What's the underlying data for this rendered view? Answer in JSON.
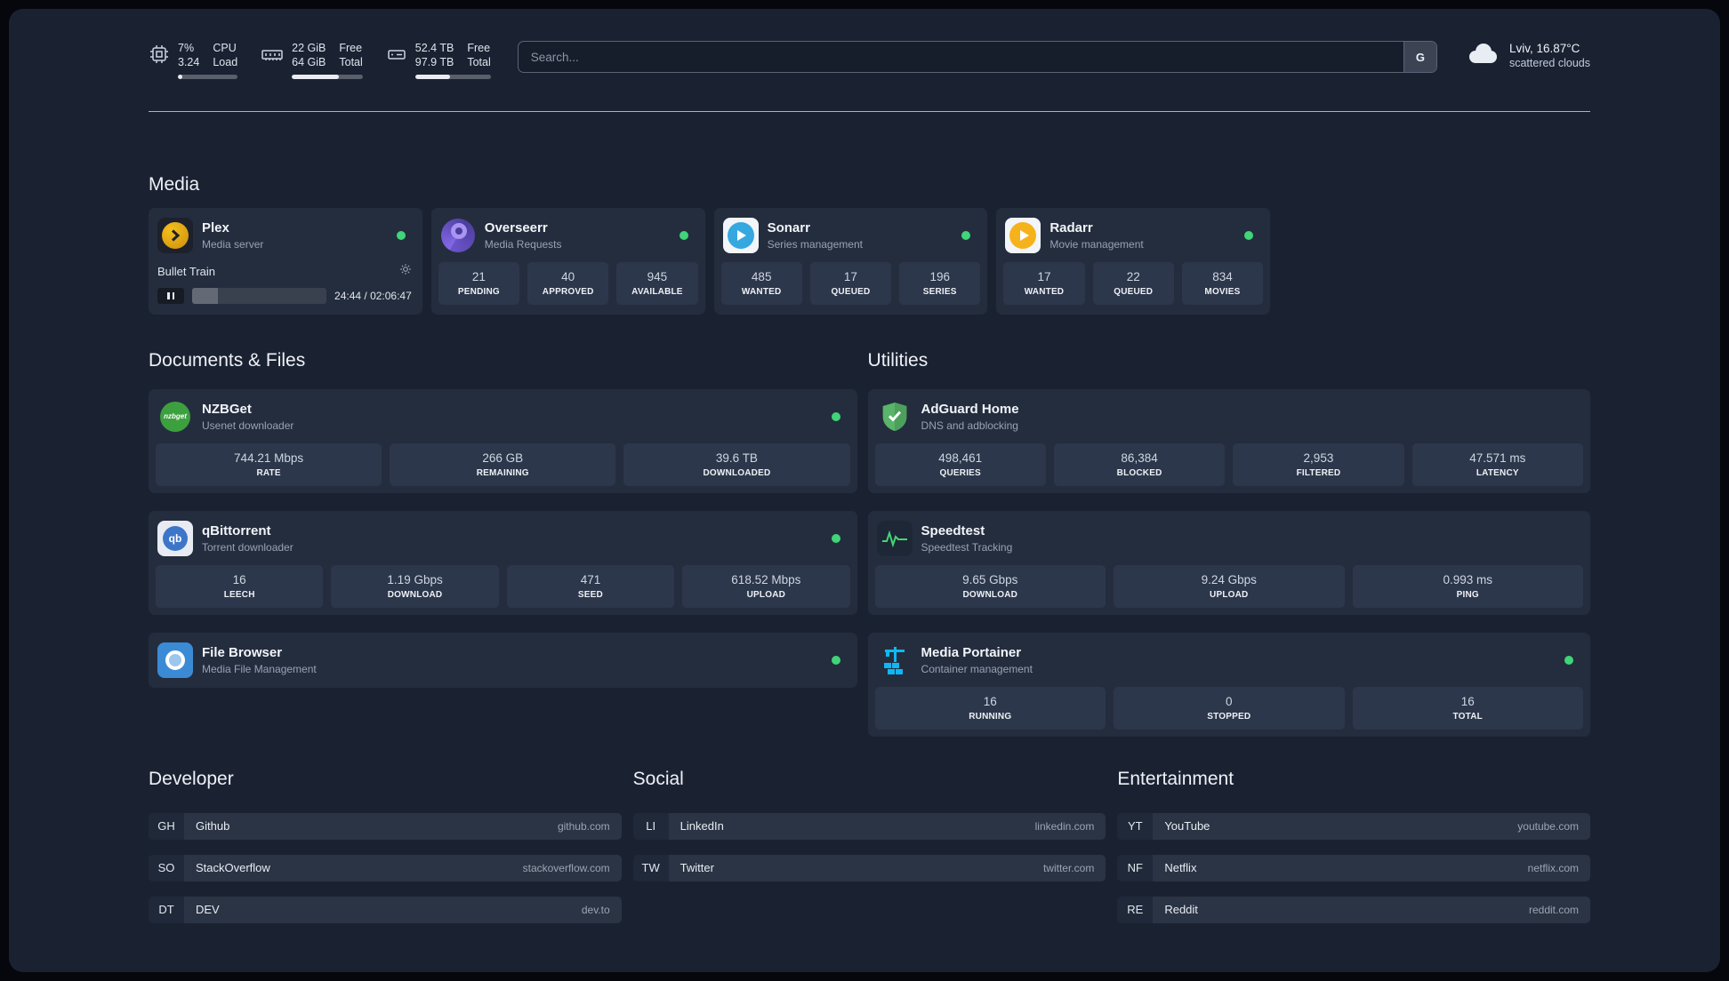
{
  "topbar": {
    "cpu": {
      "percent": "7%",
      "load": "3.24",
      "label_top": "CPU",
      "label_bottom": "Load",
      "bar_pct": 7
    },
    "memory": {
      "free": "22 GiB",
      "total": "64 GiB",
      "free_label": "Free",
      "total_label": "Total",
      "bar_pct": 66
    },
    "disk": {
      "free": "52.4 TB",
      "total": "97.9 TB",
      "free_label": "Free",
      "total_label": "Total",
      "bar_pct": 46
    },
    "search": {
      "placeholder": "Search...",
      "button": "G"
    },
    "weather": {
      "location": "Lviv, 16.87°C",
      "condition": "scattered clouds"
    }
  },
  "media": {
    "heading": "Media",
    "plex": {
      "name": "Plex",
      "desc": "Media server",
      "now_playing": "Bullet Train",
      "time": "24:44 / 02:06:47",
      "progress_pct": 19.5
    },
    "overseerr": {
      "name": "Overseerr",
      "desc": "Media Requests",
      "stats": [
        {
          "value": "21",
          "label": "PENDING"
        },
        {
          "value": "40",
          "label": "APPROVED"
        },
        {
          "value": "945",
          "label": "AVAILABLE"
        }
      ]
    },
    "sonarr": {
      "name": "Sonarr",
      "desc": "Series management",
      "stats": [
        {
          "value": "485",
          "label": "WANTED"
        },
        {
          "value": "17",
          "label": "QUEUED"
        },
        {
          "value": "196",
          "label": "SERIES"
        }
      ]
    },
    "radarr": {
      "name": "Radarr",
      "desc": "Movie management",
      "stats": [
        {
          "value": "17",
          "label": "WANTED"
        },
        {
          "value": "22",
          "label": "QUEUED"
        },
        {
          "value": "834",
          "label": "MOVIES"
        }
      ]
    }
  },
  "documents": {
    "heading": "Documents & Files",
    "nzbget": {
      "name": "NZBGet",
      "desc": "Usenet downloader",
      "icon_text": "nzbget",
      "stats": [
        {
          "value": "744.21 Mbps",
          "label": "RATE"
        },
        {
          "value": "266 GB",
          "label": "REMAINING"
        },
        {
          "value": "39.6 TB",
          "label": "DOWNLOADED"
        }
      ]
    },
    "qbittorrent": {
      "name": "qBittorrent",
      "desc": "Torrent downloader",
      "icon_text": "qb",
      "stats": [
        {
          "value": "16",
          "label": "LEECH"
        },
        {
          "value": "1.19 Gbps",
          "label": "DOWNLOAD"
        },
        {
          "value": "471",
          "label": "SEED"
        },
        {
          "value": "618.52 Mbps",
          "label": "UPLOAD"
        }
      ]
    },
    "filebrowser": {
      "name": "File Browser",
      "desc": "Media File Management"
    }
  },
  "utilities": {
    "heading": "Utilities",
    "adguard": {
      "name": "AdGuard Home",
      "desc": "DNS and adblocking",
      "stats": [
        {
          "value": "498,461",
          "label": "QUERIES"
        },
        {
          "value": "86,384",
          "label": "BLOCKED"
        },
        {
          "value": "2,953",
          "label": "FILTERED"
        },
        {
          "value": "47.571 ms",
          "label": "LATENCY"
        }
      ]
    },
    "speedtest": {
      "name": "Speedtest",
      "desc": "Speedtest Tracking",
      "stats": [
        {
          "value": "9.65 Gbps",
          "label": "DOWNLOAD"
        },
        {
          "value": "9.24 Gbps",
          "label": "UPLOAD"
        },
        {
          "value": "0.993 ms",
          "label": "PING"
        }
      ]
    },
    "portainer": {
      "name": "Media Portainer",
      "desc": "Container management",
      "stats": [
        {
          "value": "16",
          "label": "RUNNING"
        },
        {
          "value": "0",
          "label": "STOPPED"
        },
        {
          "value": "16",
          "label": "TOTAL"
        }
      ]
    }
  },
  "bookmarks": {
    "developer": {
      "heading": "Developer",
      "items": [
        {
          "abbr": "GH",
          "name": "Github",
          "domain": "github.com"
        },
        {
          "abbr": "SO",
          "name": "StackOverflow",
          "domain": "stackoverflow.com"
        },
        {
          "abbr": "DT",
          "name": "DEV",
          "domain": "dev.to"
        }
      ]
    },
    "social": {
      "heading": "Social",
      "items": [
        {
          "abbr": "LI",
          "name": "LinkedIn",
          "domain": "linkedin.com"
        },
        {
          "abbr": "TW",
          "name": "Twitter",
          "domain": "twitter.com"
        }
      ]
    },
    "entertainment": {
      "heading": "Entertainment",
      "items": [
        {
          "abbr": "YT",
          "name": "YouTube",
          "domain": "youtube.com"
        },
        {
          "abbr": "NF",
          "name": "Netflix",
          "domain": "netflix.com"
        },
        {
          "abbr": "RE",
          "name": "Reddit",
          "domain": "reddit.com"
        }
      ]
    }
  }
}
